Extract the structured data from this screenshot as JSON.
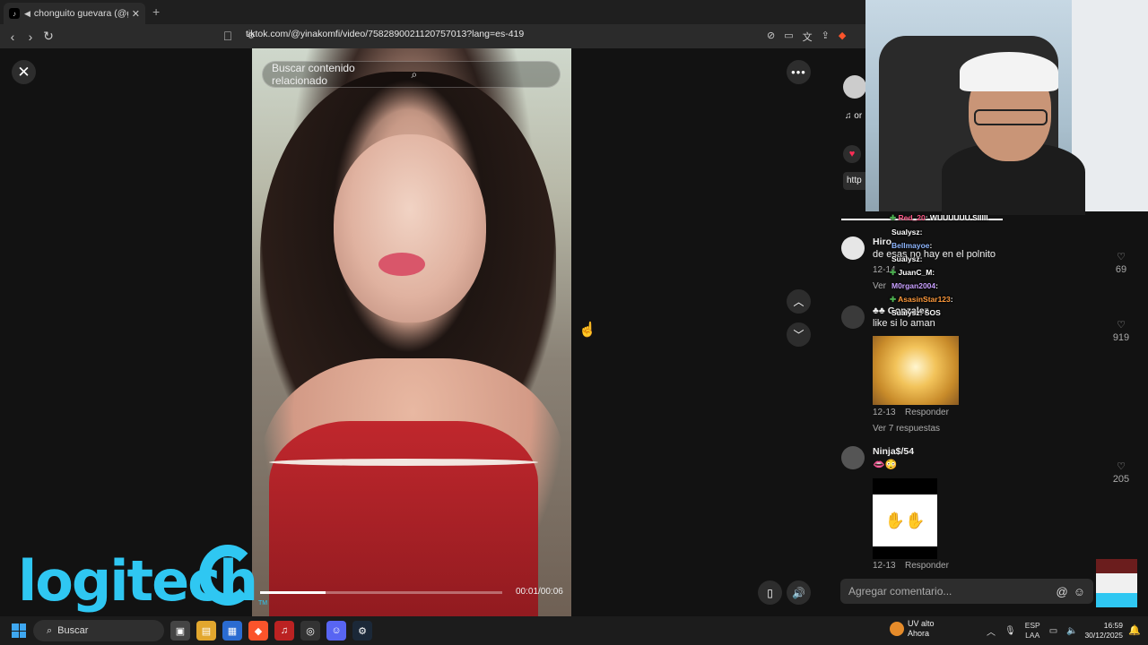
{
  "browser": {
    "tab_title": "chonguito guevara (@gvr4.m",
    "new_tab": "+",
    "url": "tiktok.com/@yinakomfi/video/7582890021120757013?lang=es-419"
  },
  "video": {
    "search_placeholder": "Buscar contenido relacionado",
    "time": "00:01/00:06",
    "progress": 0.27
  },
  "overlay": {
    "brand": "logitech",
    "tm": "TM"
  },
  "side_partial": {
    "note": "♫ or",
    "link": "http"
  },
  "comments": [
    {
      "name": "Hiro",
      "text": "de esas no hay en el polnito",
      "date": "12-14",
      "reply_link": "Ver",
      "likes": "69"
    },
    {
      "name": "♣♣ Gonzalez",
      "text": "like si lo aman",
      "date": "12-13",
      "reply": "Responder",
      "more": "Ver 7 respuestas",
      "likes": "919"
    },
    {
      "name": "Ninja$/54",
      "text": "👄😳",
      "date": "12-13",
      "reply": "Responder",
      "likes": "205"
    }
  ],
  "comment_input": {
    "placeholder": "Agregar comentario..."
  },
  "stream_chat": [
    {
      "user": "Red_20",
      "msg": ": WUUUUUU SIIIII"
    },
    {
      "user": "Sualysz",
      "msg": ":"
    },
    {
      "user": "Bellmayoe",
      "msg": ":"
    },
    {
      "user": "Sualysz",
      "msg": ":"
    },
    {
      "user": "JuanC_M",
      "msg": ":"
    },
    {
      "user": "M0rgan2004",
      "msg": ":"
    },
    {
      "user": "AsasinStar123",
      "msg": ":"
    },
    {
      "user": "Sualysz",
      "msg": ": SOS"
    }
  ],
  "taskbar": {
    "search": "Buscar",
    "weather_title": "UV alto",
    "weather_sub": "Ahora",
    "lang1": "ESP",
    "lang2": "LAA",
    "time": "16:59",
    "date": "30/12/2025"
  },
  "colors": {
    "accent": "#fe2c55",
    "logitech": "#2fc7f2",
    "taskbar": "#1c1c1c"
  }
}
